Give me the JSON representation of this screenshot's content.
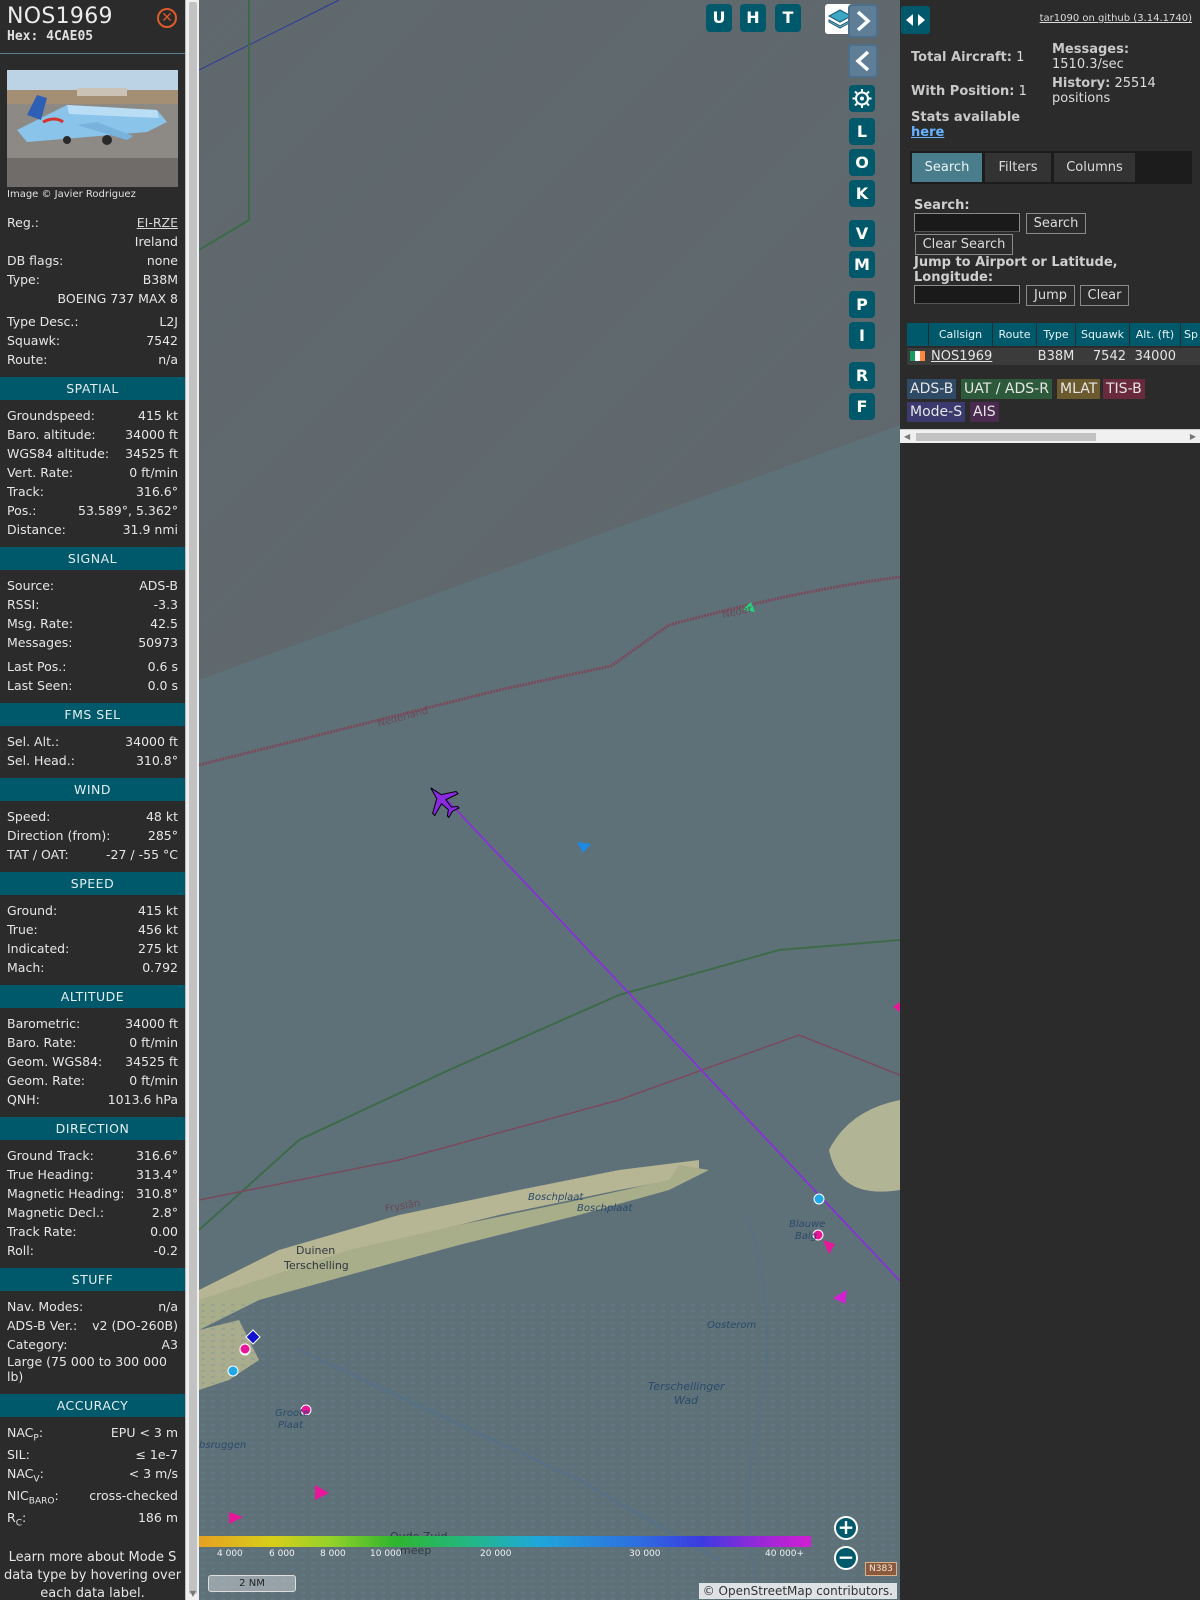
{
  "aircraft": {
    "callsign": "NOS1969",
    "hex_label": "Hex: 4CAE05",
    "photo_credit": "Image © Javier Rodriguez"
  },
  "info": {
    "reg_label": "Reg.:",
    "reg_value": "EI-RZE",
    "country": "Ireland",
    "dbflags_label": "DB flags:",
    "dbflags_value": "none",
    "type_label": "Type:",
    "type_value": "B38M",
    "type_full": "BOEING 737 MAX 8",
    "typedesc_label": "Type Desc.:",
    "typedesc_value": "L2J",
    "squawk_label": "Squawk:",
    "squawk_value": "7542",
    "route_label": "Route:",
    "route_value": "n/a"
  },
  "spatial": {
    "title": "SPATIAL",
    "rows": [
      {
        "k": "Groundspeed:",
        "v": "415 kt"
      },
      {
        "k": "Baro. altitude:",
        "v": "34000 ft"
      },
      {
        "k": "WGS84 altitude:",
        "v": "34525 ft"
      },
      {
        "k": "Vert. Rate:",
        "v": "0 ft/min"
      },
      {
        "k": "Track:",
        "v": "316.6°"
      },
      {
        "k": "Pos.:",
        "v": "53.589°, 5.362°"
      },
      {
        "k": "Distance:",
        "v": "31.9 nmi"
      }
    ]
  },
  "signal": {
    "title": "SIGNAL",
    "rows": [
      {
        "k": "Source:",
        "v": "ADS-B"
      },
      {
        "k": "RSSI:",
        "v": "-3.3"
      },
      {
        "k": "Msg. Rate:",
        "v": "42.5"
      },
      {
        "k": "Messages:",
        "v": "50973"
      },
      {
        "k": "Last Pos.:",
        "v": "0.6 s"
      },
      {
        "k": "Last Seen:",
        "v": "0.0 s"
      }
    ]
  },
  "fms": {
    "title": "FMS SEL",
    "rows": [
      {
        "k": "Sel. Alt.:",
        "v": "34000 ft"
      },
      {
        "k": "Sel. Head.:",
        "v": "310.8°"
      }
    ]
  },
  "wind": {
    "title": "WIND",
    "rows": [
      {
        "k": "Speed:",
        "v": "48 kt"
      },
      {
        "k": "Direction (from):",
        "v": "285°"
      },
      {
        "k": "TAT / OAT:",
        "v": "-27 / -55 °C"
      }
    ]
  },
  "speed": {
    "title": "SPEED",
    "rows": [
      {
        "k": "Ground:",
        "v": "415 kt"
      },
      {
        "k": "True:",
        "v": "456 kt"
      },
      {
        "k": "Indicated:",
        "v": "275 kt"
      },
      {
        "k": "Mach:",
        "v": "0.792"
      }
    ]
  },
  "altitude": {
    "title": "ALTITUDE",
    "rows": [
      {
        "k": "Barometric:",
        "v": "34000 ft"
      },
      {
        "k": "Baro. Rate:",
        "v": "0 ft/min"
      },
      {
        "k": "Geom. WGS84:",
        "v": "34525 ft"
      },
      {
        "k": "Geom. Rate:",
        "v": "0 ft/min"
      },
      {
        "k": "QNH:",
        "v": "1013.6 hPa"
      }
    ]
  },
  "direction": {
    "title": "DIRECTION",
    "rows": [
      {
        "k": "Ground Track:",
        "v": "316.6°"
      },
      {
        "k": "True Heading:",
        "v": "313.4°"
      },
      {
        "k": "Magnetic Heading:",
        "v": "310.8°"
      },
      {
        "k": "Magnetic Decl.:",
        "v": "2.8°"
      },
      {
        "k": "Track Rate:",
        "v": "0.00"
      },
      {
        "k": "Roll:",
        "v": "-0.2"
      }
    ]
  },
  "stuff": {
    "title": "STUFF",
    "rows": [
      {
        "k": "Nav. Modes:",
        "v": "n/a"
      },
      {
        "k": "ADS-B Ver.:",
        "v": "v2 (DO-260B)"
      },
      {
        "k": "Category:",
        "v": "A3"
      }
    ],
    "category_desc": "Large (75 000 to 300 000 lb)"
  },
  "accuracy": {
    "title": "ACCURACY",
    "nacp_k": "NAC",
    "nacp_sub": "P",
    "nacp_v": "EPU < 3 m",
    "sil_k": "SIL:",
    "sil_v": "≤ 1e-7",
    "nacv_k": "NAC",
    "nacv_sub": "V",
    "nacv_v": "< 3 m/s",
    "nicbaro_k": "NIC",
    "nicbaro_sub": "BARO",
    "nicbaro_v": "cross-checked",
    "rc_k": "R",
    "rc_sub": "C",
    "rc_v": "186 m"
  },
  "learn_more": "Learn more about Mode S data type by hovering over each data label.",
  "map": {
    "top_buttons": [
      "U",
      "H",
      "T"
    ],
    "side_buttons": [
      "L",
      "O",
      "K",
      "V",
      "M",
      "P",
      "I",
      "R",
      "F"
    ],
    "labels": {
      "nederland1": "Nederland",
      "nederland2": "Neder",
      "fryslan": "Fryslân",
      "boschplaat1": "Boschplaat",
      "boschplaat2": "Boschplaat",
      "duinen": "Duinen",
      "terschelling": "Terschelling",
      "blauwe": "Blauwe",
      "balg": "Balg",
      "oosterom": "Oosterom",
      "terschellinger": "Terschellinger",
      "wad": "Wad",
      "groote": "Groote",
      "plaat": "Plaat",
      "bsruggen": "bsruggen",
      "oude_zuid": "Oude Zuid",
      "meep": "meep",
      "n383": "N383"
    },
    "alt_scale": [
      "4 000",
      "6 000",
      "8 000",
      "10 000",
      "20 000",
      "30 000",
      "40 000+"
    ],
    "scale_label": "2 NM",
    "attribution_prefix": "© ",
    "attribution_link": "OpenStreetMap",
    "attribution_suffix": " contributors."
  },
  "right": {
    "github": "tar1090 on github (3.14.1740)",
    "total_label": "Total Aircraft:",
    "total_value": "1",
    "messages_label": "Messages:",
    "messages_value": "1510.3/sec",
    "withpos_label": "With Position:",
    "withpos_value": "1",
    "history_label": "History:",
    "history_value": "25514 positions",
    "stats_label": "Stats available",
    "stats_link": "here",
    "tabs": [
      "Search",
      "Filters",
      "Columns"
    ],
    "search_label": "Search:",
    "search_btn": "Search",
    "clear_search_btn": "Clear Search",
    "jump_label": "Jump to Airport or Latitude, Longitude:",
    "jump_btn": "Jump",
    "clear_btn": "Clear",
    "table_headers": [
      "Callsign",
      "Route",
      "Type",
      "Squawk",
      "Alt. (ft)",
      "Sp"
    ],
    "table_row": {
      "callsign": "NOS1969",
      "route": "",
      "type": "B38M",
      "squawk": "7542",
      "alt": "34000"
    },
    "source_chips": [
      "ADS-B",
      "UAT / ADS-R",
      "MLAT",
      "TIS-B",
      "Mode-S",
      "AIS"
    ]
  }
}
